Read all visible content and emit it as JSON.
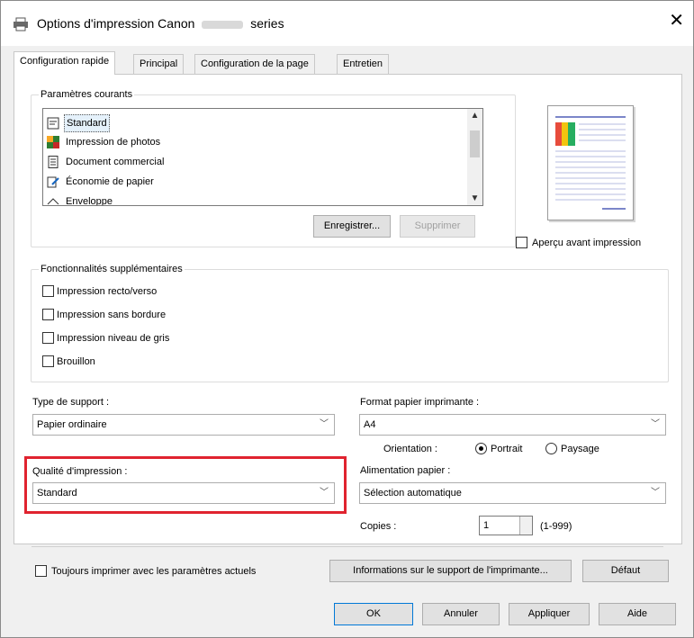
{
  "window": {
    "title_prefix": "Options d'impression Canon",
    "title_suffix": "series",
    "close_glyph": "✕"
  },
  "tabs": [
    {
      "label": "Configuration rapide",
      "active": true
    },
    {
      "label": "Principal",
      "active": false
    },
    {
      "label": "Configuration de la page",
      "active": false
    },
    {
      "label": "Entretien",
      "active": false
    }
  ],
  "current_settings": {
    "legend": "Paramètres courants",
    "items": [
      {
        "label": "Standard",
        "icon": "standard-icon",
        "selected": true
      },
      {
        "label": "Impression de photos",
        "icon": "photo-icon",
        "selected": false
      },
      {
        "label": "Document commercial",
        "icon": "document-icon",
        "selected": false
      },
      {
        "label": "Économie de papier",
        "icon": "paper-saving-icon",
        "selected": false
      },
      {
        "label": "Enveloppe",
        "icon": "envelope-icon",
        "selected": false
      }
    ],
    "save_button": "Enregistrer...",
    "delete_button": "Supprimer"
  },
  "preview": {
    "checkbox_label": "Aperçu avant impression",
    "checked": false
  },
  "additional_features": {
    "legend": "Fonctionnalités supplémentaires",
    "options": [
      {
        "label": "Impression recto/verso",
        "checked": false
      },
      {
        "label": "Impression sans bordure",
        "checked": false
      },
      {
        "label": "Impression niveau de gris",
        "checked": false
      },
      {
        "label": "Brouillon",
        "checked": false
      }
    ]
  },
  "media_type": {
    "label": "Type de support :",
    "value": "Papier ordinaire"
  },
  "print_quality": {
    "label": "Qualité d'impression :",
    "value": "Standard"
  },
  "printer_paper_size": {
    "label": "Format papier imprimante :",
    "value": "A4"
  },
  "orientation": {
    "label": "Orientation :",
    "portrait": "Portrait",
    "landscape": "Paysage",
    "selected": "portrait"
  },
  "paper_source": {
    "label": "Alimentation papier :",
    "value": "Sélection automatique"
  },
  "copies": {
    "label": "Copies :",
    "value": "1",
    "range": "(1-999)"
  },
  "bottom": {
    "always_print_label": "Toujours imprimer avec les paramètres actuels",
    "media_info_button": "Informations sur le support de l'imprimante...",
    "default_button": "Défaut"
  },
  "dialog_buttons": {
    "ok": "OK",
    "cancel": "Annuler",
    "apply": "Appliquer",
    "help": "Aide"
  },
  "colors": {
    "highlight": "#e0232f",
    "window_bg": "#f0f0f0",
    "panel_bg": "#ffffff"
  }
}
